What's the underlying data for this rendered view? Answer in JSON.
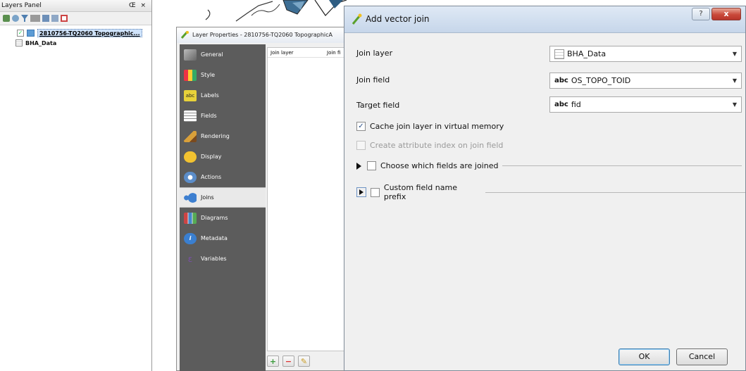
{
  "layers_panel": {
    "title": "Layers Panel",
    "title_controls": "Œ ×",
    "layers": [
      {
        "name": "2810756-TQ2060 Topographic...",
        "checked": true,
        "selected": true
      },
      {
        "name": "BHA_Data",
        "checked": false,
        "selected": false
      }
    ]
  },
  "layer_properties": {
    "title": "Layer Properties - 2810756-TQ2060 TopographicA",
    "sidebar": [
      {
        "label": "General",
        "icon": "wrench-icon"
      },
      {
        "label": "Style",
        "icon": "paint-icon"
      },
      {
        "label": "Labels",
        "icon": "abc-label-icon"
      },
      {
        "label": "Fields",
        "icon": "table-icon"
      },
      {
        "label": "Rendering",
        "icon": "brush-icon"
      },
      {
        "label": "Display",
        "icon": "speech-bubble-icon"
      },
      {
        "label": "Actions",
        "icon": "gear-icon"
      },
      {
        "label": "Joins",
        "icon": "join-icon",
        "active": true
      },
      {
        "label": "Diagrams",
        "icon": "chart-icon"
      },
      {
        "label": "Metadata",
        "icon": "info-icon"
      },
      {
        "label": "Variables",
        "icon": "epsilon-icon"
      }
    ],
    "joins_table": {
      "columns": [
        "Join layer",
        "Join fi"
      ]
    },
    "buttons": {
      "add": "+",
      "remove": "−",
      "edit": "✎"
    }
  },
  "dialog": {
    "title": "Add vector join",
    "help": "?",
    "close": "x",
    "join_layer": {
      "label": "Join layer",
      "value": "BHA_Data"
    },
    "join_field": {
      "label": "Join field",
      "type_prefix": "abc",
      "value": "OS_TOPO_TOID"
    },
    "target_field": {
      "label": "Target field",
      "type_prefix": "abc",
      "value": "fid"
    },
    "cache_checkbox": {
      "label": "Cache join layer in virtual memory",
      "checked": true
    },
    "index_checkbox": {
      "label": "Create attribute index on join field",
      "checked": false,
      "enabled": false
    },
    "fields_group": {
      "label": "Choose which fields are joined",
      "checked": false
    },
    "prefix_group": {
      "label": "Custom field name prefix",
      "checked": false
    },
    "ok": "OK",
    "cancel": "Cancel"
  },
  "colors": {
    "sidebar_bg": "#5c5c5c",
    "selected_layer_bg": "#cfe3fb",
    "close_button": "#c9493a",
    "title_bar": "#dfe9f5"
  }
}
